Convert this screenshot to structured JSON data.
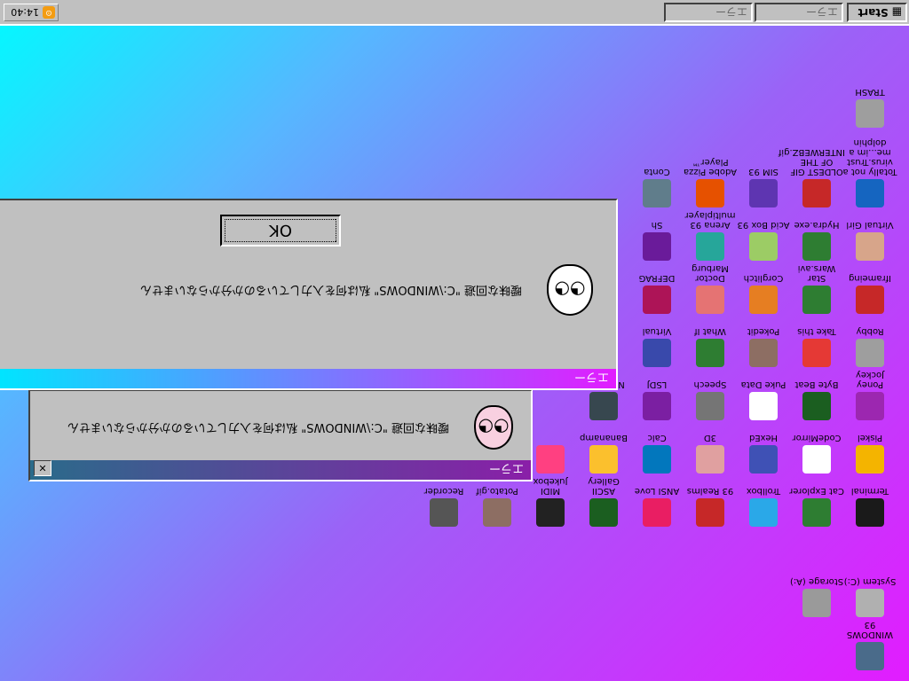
{
  "taskbar": {
    "start_label": "Start",
    "window_tasks": [
      "エラー",
      "エラー"
    ],
    "tray_time": "14:40"
  },
  "icons": [
    {
      "label": "WINDOWS 93",
      "icon": "windows93-icon",
      "color": "#4a6b8a"
    },
    {
      "label": "System (C:)",
      "icon": "hard-drive-icon",
      "color": "#b0b0b0"
    },
    {
      "label": "Storage (A:)",
      "icon": "floppy-drive-icon",
      "color": "#9a9a9a"
    },
    {
      "label": "Terminal",
      "icon": "terminal-icon",
      "color": "#1a1a1a"
    },
    {
      "label": "Cat Explorer",
      "icon": "cat-globe-icon",
      "color": "#2e7d32"
    },
    {
      "label": "Trollbox",
      "icon": "trollbox-icon",
      "color": "#2aa8e8"
    },
    {
      "label": "93 Realms",
      "icon": "realms-icon",
      "color": "#c62828"
    },
    {
      "label": "ANSI Love",
      "icon": "ansi-love-icon",
      "color": "#e91e63"
    },
    {
      "label": "ASCII Gallery",
      "icon": "ascii-gallery-icon",
      "color": "#1b5e20"
    },
    {
      "label": "MIDI Jukebox",
      "icon": "midi-jukebox-icon",
      "color": "#222222"
    },
    {
      "label": "Potato.gif",
      "icon": "potato-icon",
      "color": "#8d6e63"
    },
    {
      "label": "Recorder",
      "icon": "recorder-icon",
      "color": "#555555"
    },
    {
      "label": "Piskel",
      "icon": "piskel-icon",
      "color": "#f4b400"
    },
    {
      "label": "CodeMirror",
      "icon": "codemirror-icon",
      "color": "#ffffff"
    },
    {
      "label": "HexEd",
      "icon": "hexed-icon",
      "color": "#3f51b5"
    },
    {
      "label": "3D",
      "icon": "3d-icon",
      "color": "#e0a0a0"
    },
    {
      "label": "Calc",
      "icon": "calc-icon",
      "color": "#0277bd"
    },
    {
      "label": "Bananamp",
      "icon": "bananamp-icon",
      "color": "#fbc02d"
    },
    {
      "label": "",
      "icon": "blank-icon",
      "color": "#ff4081"
    },
    {
      "label": "",
      "icon": "amiga-ball-icon",
      "color": "#e53935"
    },
    {
      "label": "",
      "icon": "maze-icon",
      "color": "#6a1b9a"
    },
    {
      "label": "Poney Jockey",
      "icon": "poney-icon",
      "color": "#9c27b0"
    },
    {
      "label": "Byte Beat",
      "icon": "bytebeat-icon",
      "color": "#1b5e20"
    },
    {
      "label": "Puke Data",
      "icon": "pukedata-icon",
      "color": "#ffffff"
    },
    {
      "label": "Speech",
      "icon": "speech-icon",
      "color": "#757575"
    },
    {
      "label": "LSDJ",
      "icon": "lsdj-icon",
      "color": "#7b1fa2"
    },
    {
      "label": "Nanoloop",
      "icon": "nanoloop-icon",
      "color": "#37474f"
    },
    {
      "label": "Robby",
      "icon": "robby-icon",
      "color": "#9e9e9e"
    },
    {
      "label": "Take this",
      "icon": "take-this-icon",
      "color": "#e53935"
    },
    {
      "label": "Pokedit",
      "icon": "pokedit-icon",
      "color": "#8d6e63"
    },
    {
      "label": "What If",
      "icon": "what-if-icon",
      "color": "#2e7d32"
    },
    {
      "label": "Virtual",
      "icon": "virtual-icon",
      "color": "#3949ab"
    },
    {
      "label": "Iframeing",
      "icon": "iframeing-icon",
      "color": "#c62828"
    },
    {
      "label": "Star Wars.avi",
      "icon": "star-wars-icon",
      "color": "#2e7d32"
    },
    {
      "label": "Corglitch",
      "icon": "corglitch-icon",
      "color": "#e67e22"
    },
    {
      "label": "Doctor Marburg",
      "icon": "doctor-icon",
      "color": "#e57373"
    },
    {
      "label": "DEFRAG",
      "icon": "defrag-icon",
      "color": "#ad1457"
    },
    {
      "label": "Virtual Girl",
      "icon": "virtual-girl-icon",
      "color": "#d7a58a"
    },
    {
      "label": "Hydra.exe",
      "icon": "hydra-icon",
      "color": "#2e7d32"
    },
    {
      "label": "Acid Box 93",
      "icon": "acid-box-icon",
      "color": "#9ccc65"
    },
    {
      "label": "Arena 93 multiplayer",
      "icon": "arena-icon",
      "color": "#26a69a"
    },
    {
      "label": "Sh",
      "icon": "sh-icon",
      "color": "#6a1b9a"
    },
    {
      "label": "Totally not a virus.Trust me...im a dolphin",
      "icon": "dolphin-icon",
      "color": "#1565c0"
    },
    {
      "label": "OLDEST GIF OF THE INTERWEBZ.gif",
      "icon": "oldest-gif-icon",
      "color": "#c62828"
    },
    {
      "label": "SIM 93",
      "icon": "sim93-icon",
      "color": "#5e35b1"
    },
    {
      "label": "Adobe Pizza Player™",
      "icon": "pizza-icon",
      "color": "#e65100"
    },
    {
      "label": "Conta",
      "icon": "contacts-icon",
      "color": "#607d8b"
    },
    {
      "label": "TRASH",
      "icon": "trash-icon",
      "color": "#9e9e9e"
    }
  ],
  "dialogs": [
    {
      "title": "エラー",
      "message": "曖昧な回避 \"C:\\WINDOWS\" 私は何を入力しているのか分からないません",
      "ok_label": "OK"
    },
    {
      "title": "エラー",
      "message": "曖昧な回避 \"C:\\WINDOWS\" 私は何を入力しているのか分からないません",
      "close_label": "✕"
    }
  ]
}
